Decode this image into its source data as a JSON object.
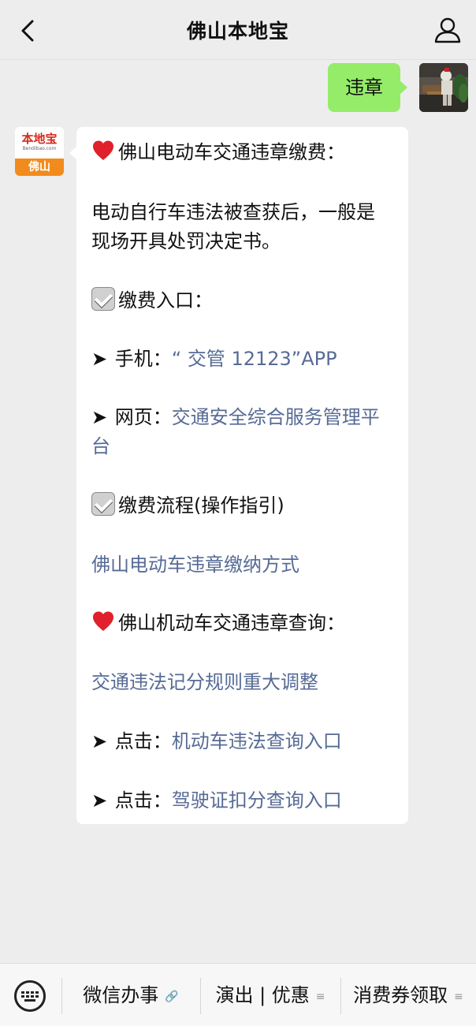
{
  "header": {
    "title": "佛山本地宝"
  },
  "user_message": {
    "text": "违章"
  },
  "bot_avatar": {
    "logo_name": "本地宝",
    "logo_url": "Bendibao.com",
    "logo_city": "佛山"
  },
  "bot_message": {
    "lines": [
      {
        "prefix": "",
        "text": "佛山电动车交通违章缴费：",
        "link": ""
      },
      {
        "prefix": "",
        "text": "电动自行车违法被查获后，一般是",
        "link": ""
      },
      {
        "prefix": "",
        "text": "现场开具处罚决定书。",
        "link": ""
      },
      {
        "prefix": "",
        "text": "缴费入口：",
        "link": ""
      },
      {
        "prefix": "➤",
        "text": " 手机：",
        "link": "“ 交管 12123”APP"
      },
      {
        "prefix": "➤",
        "text": " 网页：",
        "link": "交通安全综合服务管理平"
      },
      {
        "prefix": "",
        "text": "",
        "link": "台"
      },
      {
        "prefix": "",
        "text": "缴费流程(操作指引)",
        "link": ""
      },
      {
        "prefix": "",
        "text": "",
        "link": "佛山电动车违章缴纳方式"
      },
      {
        "prefix": "",
        "text": "佛山机动车交通违章查询：",
        "link": ""
      },
      {
        "prefix": "",
        "text": "",
        "link": "交通违法记分规则重大调整"
      },
      {
        "prefix": "➤",
        "text": " 点击：",
        "link": "机动车违法查询入口"
      },
      {
        "prefix": "➤",
        "text": " 点击：",
        "link": "驾驶证扣分查询入口"
      }
    ]
  },
  "bottom_menu": {
    "items": [
      {
        "label": "微信办事",
        "icon": "link-icon"
      },
      {
        "label": "演出 | 优惠",
        "icon": "menu-icon"
      },
      {
        "label": "消费券领取",
        "icon": "menu-icon"
      }
    ]
  },
  "colors": {
    "user_bubble": "#95ec69",
    "link": "#576b95",
    "background": "#ededed"
  }
}
